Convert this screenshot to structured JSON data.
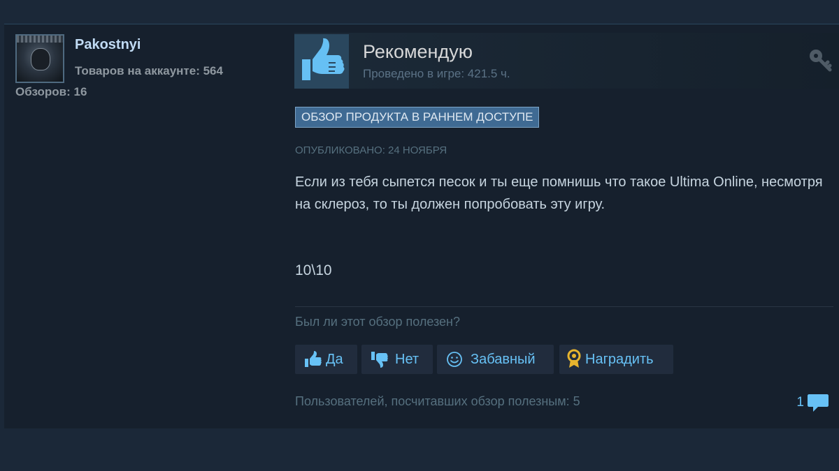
{
  "author": {
    "name": "Pakostnyi",
    "games_owned": "Товаров на аккаунте: 564",
    "reviews": "Обзоров: 16"
  },
  "review": {
    "verdict": "Рекомендую",
    "playtime": "Проведено в игре: 421.5 ч.",
    "early_access_badge": "ОБЗОР ПРОДУКТА В РАННЕМ ДОСТУПЕ",
    "posted": "ОПУБЛИКОВАНО: 24 НОЯБРЯ",
    "text": "Если из тебя сыпется песок и ты еще помнишь что такое Ultima Online, несмотря на склероз, то ты должен попробовать эту игру.",
    "score": "10\\10"
  },
  "feedback": {
    "question": "Был ли этот обзор полезен?",
    "yes_label": "Да",
    "no_label": "Нет",
    "funny_label": "Забавный",
    "award_label": "Наградить",
    "helpful_count": "Пользователей, посчитавших обзор полезным: 5",
    "comment_count": "1"
  },
  "icons": {
    "thumb": "thumbs-up-icon",
    "key": "key-icon",
    "yes": "thumbs-up-icon",
    "no": "thumbs-down-icon",
    "funny": "smiley-icon",
    "award": "award-icon",
    "comments": "comment-icon"
  },
  "colors": {
    "background": "#1b2838",
    "card": "#16202d",
    "accent": "#67c1f5",
    "badge": "#3f6a93",
    "award": "#e7b42e"
  }
}
